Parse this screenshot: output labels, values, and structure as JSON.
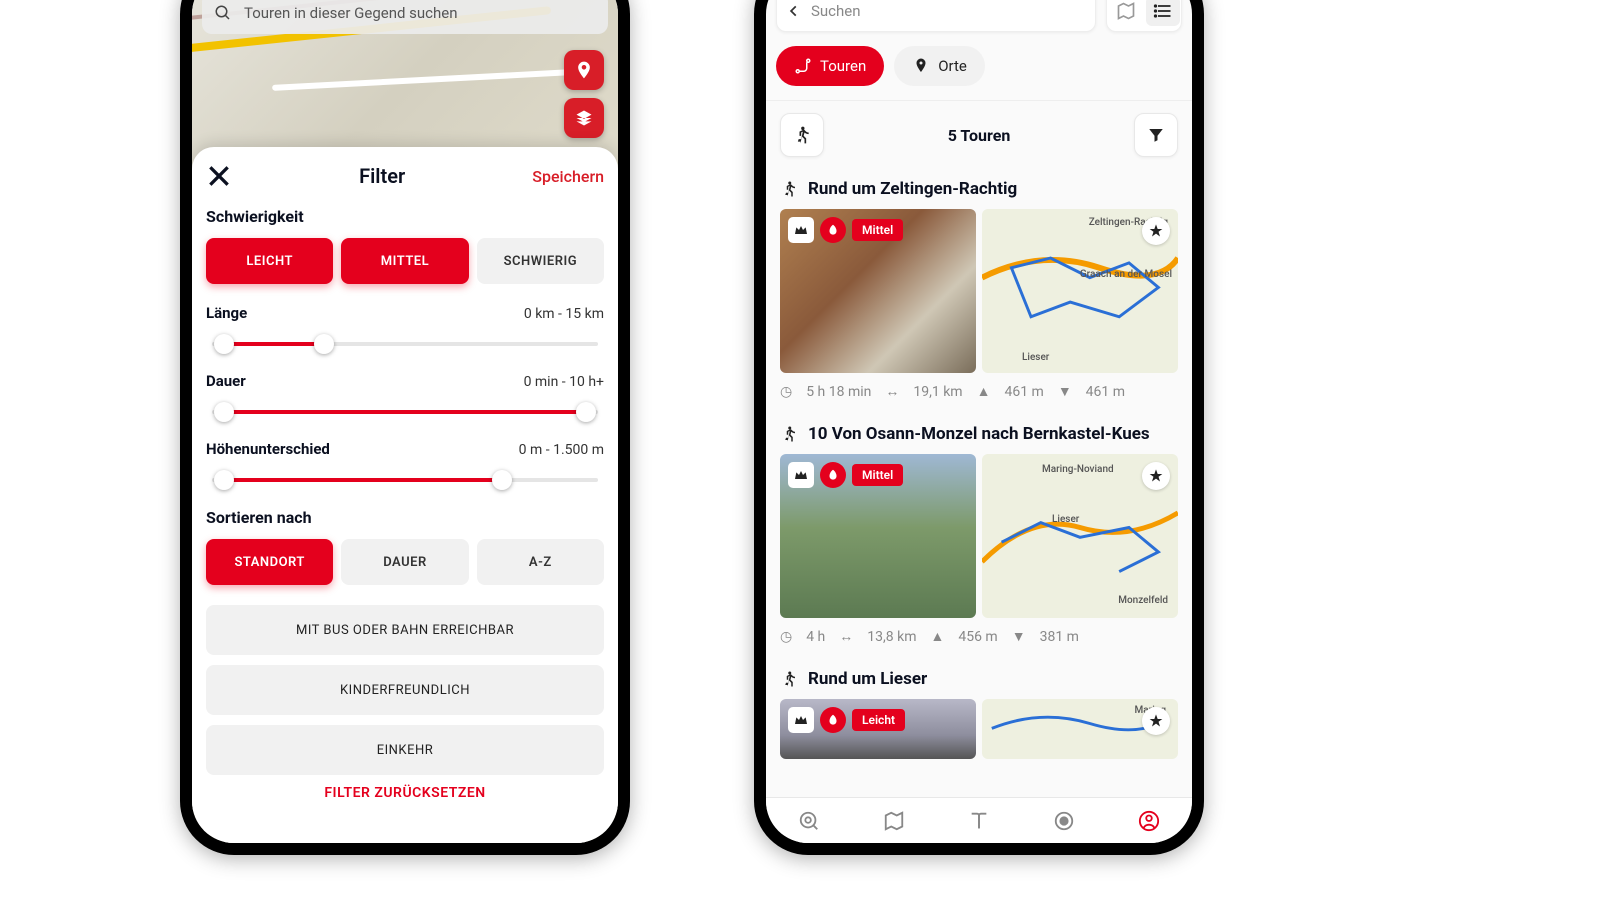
{
  "left": {
    "search_placeholder": "Touren in dieser Gegend suchen",
    "sheet": {
      "title": "Filter",
      "save": "Speichern",
      "difficulty": {
        "label": "Schwierigkeit",
        "options": [
          "LEICHT",
          "MITTEL",
          "SCHWIERIG"
        ]
      },
      "length": {
        "label": "Länge",
        "value": "0 km - 15 km"
      },
      "duration": {
        "label": "Dauer",
        "value": "0 min - 10 h+"
      },
      "elev": {
        "label": "Höhenunterschied",
        "value": "0 m - 1.500 m"
      },
      "sort": {
        "label": "Sortieren nach",
        "options": [
          "STANDORT",
          "DAUER",
          "A-Z"
        ]
      },
      "extra": [
        "MIT BUS ODER BAHN ERREICHBAR",
        "KINDERFREUNDLICH",
        "EINKEHR"
      ],
      "reset": "FILTER ZURÜCKSETZEN"
    }
  },
  "right": {
    "search_placeholder": "Suchen",
    "chips": {
      "tours": "Touren",
      "places": "Orte"
    },
    "count": "5 Touren",
    "tours": [
      {
        "title": "Rund um Zeltingen-Rachtig",
        "badge": "Mittel",
        "stats": {
          "time": "5 h 18 min",
          "dist": "19,1 km",
          "up": "461 m",
          "down": "461 m"
        },
        "map_labels": [
          "Zeltingen-Rachtig",
          "Graach an der Mosel",
          "Lieser"
        ]
      },
      {
        "title": "10 Von Osann-Monzel nach Bernkastel-Kues",
        "badge": "Mittel",
        "stats": {
          "time": "4 h",
          "dist": "13,8 km",
          "up": "456 m",
          "down": "381 m"
        },
        "map_labels": [
          "Maring-Noviand",
          "Lieser",
          "Monzelfeld"
        ]
      },
      {
        "title": "Rund um Lieser",
        "badge": "Leicht",
        "stats": {
          "time": "",
          "dist": "",
          "up": "",
          "down": ""
        },
        "map_labels": [
          "Maring"
        ]
      }
    ]
  }
}
